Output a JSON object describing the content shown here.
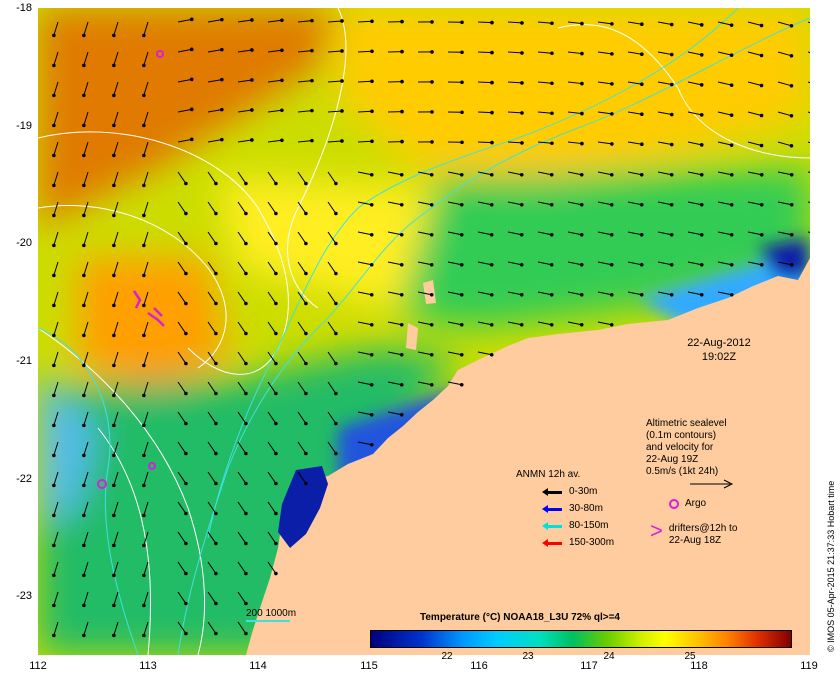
{
  "map": {
    "datetime_date": "22-Aug-2012",
    "datetime_time": "19:02Z",
    "y_ticks": [
      "-18",
      "-19",
      "-20",
      "-21",
      "-22",
      "-23"
    ],
    "x_ticks": [
      "112",
      "113",
      "114",
      "115",
      "116",
      "117",
      "118",
      "119"
    ],
    "lon_range": [
      112,
      119
    ],
    "lat_range": [
      -23.5,
      -18
    ],
    "colors": {
      "land": "#fecc9e",
      "warm": "#ff9a00",
      "mid": "#ffee00",
      "cool": "#22c84a",
      "cold": "#00b8e6",
      "coldest": "#0b1ea8",
      "argo": "#d81fd8",
      "contour_cyan": "#40e0e0"
    }
  },
  "altimetric": {
    "lines": [
      "Altimetric sealevel",
      "(0.1m contours)",
      "and velocity for",
      "22-Aug 19Z",
      "0.5m/s (1kt 24h)"
    ]
  },
  "anmn": {
    "title": "ANMN 12h av.",
    "items": [
      {
        "label": "0-30m",
        "color": "#000000"
      },
      {
        "label": "30-80m",
        "color": "#0000ff"
      },
      {
        "label": "80-150m",
        "color": "#00e0e0"
      },
      {
        "label": "150-300m",
        "color": "#ff0000"
      }
    ]
  },
  "argo": {
    "label": "Argo"
  },
  "drifters": {
    "line1": "drifters@12h to",
    "line2": "22-Aug 18Z"
  },
  "colorbar": {
    "title": "Temperature (°C) NOAA18_L3U 72% ql>=4",
    "ticks": [
      "22",
      "23",
      "24",
      "25"
    ]
  },
  "contours": {
    "label": "200  1000m"
  },
  "credit": "© IMOS 05-Apr-2015 21:37:33 Hobart time"
}
